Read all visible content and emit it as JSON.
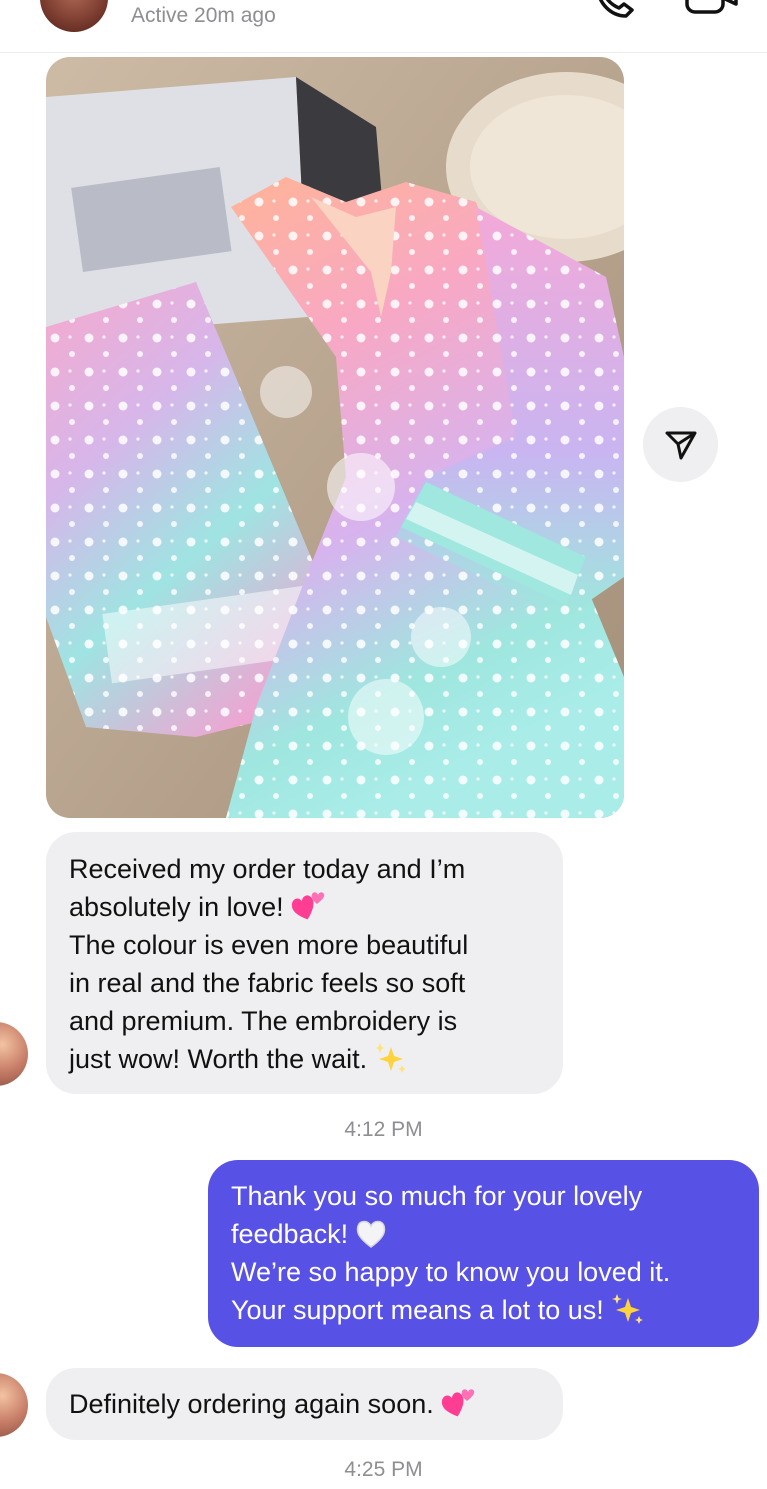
{
  "header": {
    "status": "Active 20m ago",
    "call_icon": "phone-icon",
    "video_icon": "video-camera-icon"
  },
  "photo": {
    "subject": "pastel embroidered kurta set on a sofa"
  },
  "send_button": {
    "icon": "paper-plane-icon"
  },
  "messages": [
    {
      "direction": "incoming",
      "lines": [
        "Received my order today and I’m",
        "absolutely in love!",
        "The colour is even more beautiful",
        "in real and the fabric feels so soft",
        "and premium. The embroidery is",
        "just wow! Worth the wait."
      ],
      "emojis": [
        "two-hearts-emoji",
        "sparkles-emoji"
      ]
    },
    {
      "direction": "outgoing",
      "lines": [
        "Thank you so much for your lovely",
        "feedback!",
        "We’re so happy to know you loved it.",
        "Your support means a lot to us!"
      ],
      "emojis": [
        "white-heart-emoji",
        "sparkles-emoji"
      ]
    },
    {
      "direction": "incoming",
      "lines": [
        "Definitely ordering again soon."
      ],
      "emojis": [
        "two-hearts-emoji"
      ]
    }
  ],
  "timestamps": [
    "4:12 PM",
    "4:25 PM"
  ],
  "colors": {
    "outgoing_bubble": "#5851e6",
    "incoming_bubble": "#efeff1",
    "meta_text": "#8e8e93"
  }
}
